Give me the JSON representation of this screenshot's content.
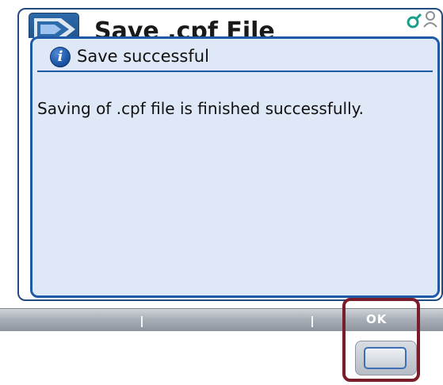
{
  "background_window": {
    "title": "Save .cpf File",
    "icon": "app-arrow-icon",
    "status_icons": [
      "network-icon",
      "user-icon"
    ]
  },
  "dialog": {
    "icon": "info-icon",
    "icon_glyph": "i",
    "title": "Save successful",
    "message": "Saving of .cpf file is finished successfully."
  },
  "toolbar": {
    "ok_label": "OK"
  },
  "colors": {
    "accent": "#1f5aa8",
    "dialog_background": "#dfe8f6",
    "highlight": "#7a1d2a",
    "toolbar": "#aab0b8"
  }
}
